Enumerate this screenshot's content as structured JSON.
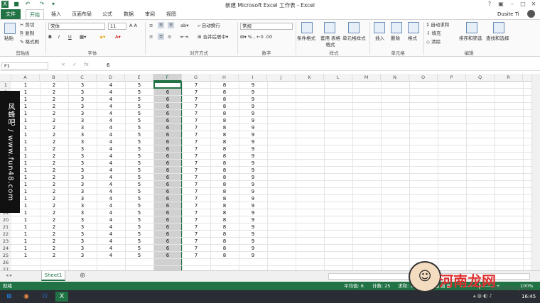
{
  "window": {
    "title": "新建 Microsoft Excel 工作表 - Excel",
    "user": "Dusite Ti"
  },
  "tabs": [
    "文件",
    "开始",
    "插入",
    "页面布局",
    "公式",
    "数据",
    "审阅",
    "视图"
  ],
  "ribbon": {
    "clipboard": {
      "paste": "粘贴",
      "cut": "剪切",
      "copy": "复制",
      "painter": "格式刷",
      "group": "剪贴板"
    },
    "font": {
      "name": "宋体",
      "size": "11",
      "bold": "B",
      "italic": "I",
      "underline": "U",
      "group": "字体"
    },
    "align": {
      "wrap": "自动换行",
      "merge": "合并后居中",
      "group": "对齐方式"
    },
    "number": {
      "format": "常规",
      "group": "数字"
    },
    "styles": {
      "cond": "条件格式",
      "table": "套用 表格格式",
      "cell": "单元格样式",
      "group": "样式"
    },
    "cells": {
      "insert": "插入",
      "delete": "删除",
      "format": "格式",
      "group": "单元格"
    },
    "editing": {
      "autosum": "自动求和",
      "fill": "填充",
      "clear": "清除",
      "sort": "排序和筛选",
      "find": "查找和选择",
      "group": "编辑"
    }
  },
  "formula_bar": {
    "name_box": "F1",
    "fx": "× ✓ fx",
    "value": "6"
  },
  "grid": {
    "columns": [
      "A",
      "B",
      "C",
      "D",
      "E",
      "F",
      "G",
      "H",
      "I",
      "J",
      "K",
      "L",
      "M",
      "N",
      "O",
      "P",
      "Q",
      "R"
    ],
    "row_values": [
      "1",
      "2",
      "3",
      "4",
      "5",
      "6",
      "7",
      "8",
      "9"
    ],
    "row_count": 25,
    "extra_rows": [
      "26",
      "27"
    ],
    "selected_column": "F",
    "active_cell": "F1"
  },
  "sheet": {
    "tab": "Sheet1",
    "add": "⊕"
  },
  "status": {
    "ready": "就绪",
    "average": "平均值: 6",
    "count": "计数: 25",
    "sum": "求和: 150",
    "zoom": "100%"
  },
  "taskbar": {
    "time": "16:45"
  },
  "watermarks": {
    "side": "风蜂吧 / www.fun48.com",
    "brand": "河南龙网",
    "site": "www.hnlong.cn"
  },
  "colors": {
    "accent": "#217346"
  }
}
